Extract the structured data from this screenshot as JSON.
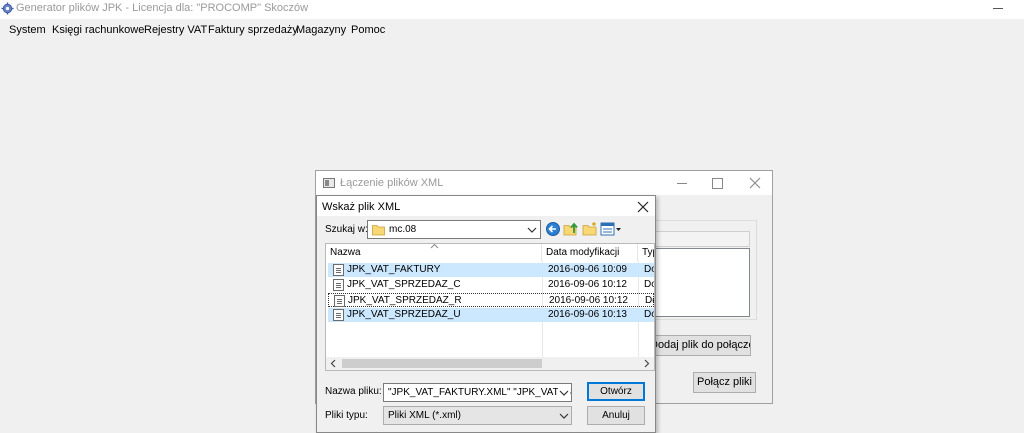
{
  "app": {
    "title": "Generator plików JPK - Licencja dla: \"PROCOMP\" Skoczów",
    "icon": "gears-icon"
  },
  "menu": {
    "items": [
      {
        "label": "System"
      },
      {
        "label": "Księgi rachunkowe"
      },
      {
        "label": "Rejestry VAT"
      },
      {
        "label": "Faktury sprzedaży"
      },
      {
        "label": "Magazyny"
      },
      {
        "label": "Pomoc"
      }
    ]
  },
  "merge_dialog": {
    "title": "Łączenie plików XML",
    "add_file_button": "Dodaj plik do połączenia",
    "merge_button": "Połącz pliki"
  },
  "file_dialog": {
    "title": "Wskaż plik XML",
    "look_in_label": "Szukaj w:",
    "look_in_value": "mc.08",
    "columns": {
      "name": "Nazwa",
      "date": "Data modyfikacji",
      "type": "Typ"
    },
    "files": [
      {
        "name": "JPK_VAT_FAKTURY",
        "date": "2016-09-06 10:09",
        "type": "Dokument XML",
        "selected": true
      },
      {
        "name": "JPK_VAT_SPRZEDAZ_C",
        "date": "2016-09-06 10:12",
        "type": "Dokument XML",
        "selected": false
      },
      {
        "name": "JPK_VAT_SPRZEDAZ_R",
        "date": "2016-09-06 10:12",
        "type": "Dokument XML",
        "selected": false
      },
      {
        "name": "JPK_VAT_SPRZEDAZ_U",
        "date": "2016-09-06 10:13",
        "type": "Dokument XML",
        "selected": true
      }
    ],
    "filename_label": "Nazwa pliku:",
    "filename_value": "\"JPK_VAT_FAKTURY.XML\" \"JPK_VAT_SPRZEDAZ_U.XML\"",
    "filetype_label": "Pliki typu:",
    "filetype_value": "Pliki XML (*.xml)",
    "open_button": "Otwórz",
    "cancel_button": "Anuluj"
  },
  "colors": {
    "selection": "#cce8ff",
    "accent": "#0078d7",
    "dialog_bg": "#f0f0f0"
  }
}
